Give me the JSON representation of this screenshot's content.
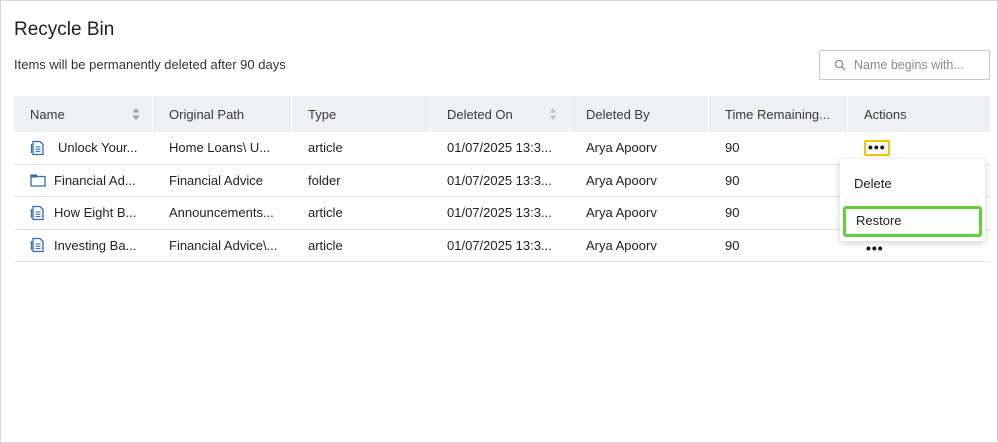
{
  "page": {
    "title": "Recycle Bin",
    "subtitle": "Items will be permanently deleted after 90 days"
  },
  "search": {
    "placeholder": "Name begins with...",
    "icon": "search-icon"
  },
  "table": {
    "columns": [
      {
        "label": "Name",
        "sortable": true
      },
      {
        "label": "Original Path",
        "sortable": false
      },
      {
        "label": "Type",
        "sortable": false
      },
      {
        "label": "Deleted On",
        "sortable": true
      },
      {
        "label": "Deleted By",
        "sortable": false
      },
      {
        "label": "Time Remaining...",
        "sortable": false
      },
      {
        "label": "Actions",
        "sortable": false
      }
    ],
    "rows": [
      {
        "icon": "article-icon",
        "name": "Unlock Your...",
        "path": "Home Loans\\ U...",
        "type": "article",
        "deleted_on": "01/07/2025 13:3...",
        "deleted_by": "Arya Apoorv",
        "time_remaining": "90",
        "actions": "•••"
      },
      {
        "icon": "folder-icon",
        "name": "Financial Ad...",
        "path": "Financial Advice",
        "type": "folder",
        "deleted_on": "01/07/2025 13:3...",
        "deleted_by": "Arya Apoorv",
        "time_remaining": "90",
        "actions": "•••"
      },
      {
        "icon": "article-icon",
        "name": "How Eight B...",
        "path": "Announcements...",
        "type": "article",
        "deleted_on": "01/07/2025 13:3...",
        "deleted_by": "Arya Apoorv",
        "time_remaining": "90",
        "actions": "•••"
      },
      {
        "icon": "article-icon",
        "name": "Investing Ba...",
        "path": "Financial Advice\\...",
        "type": "article",
        "deleted_on": "01/07/2025 13:3...",
        "deleted_by": "Arya Apoorv",
        "time_remaining": "90",
        "actions": "•••"
      }
    ]
  },
  "actions_menu": {
    "items": [
      "Delete",
      "Restore"
    ],
    "highlighted": "Restore"
  },
  "colors": {
    "header_bg": "#eef0f2",
    "icon_blue": "#2f6db5",
    "active_dots_border": "#f5c400",
    "highlight_border": "#5fd13a"
  }
}
